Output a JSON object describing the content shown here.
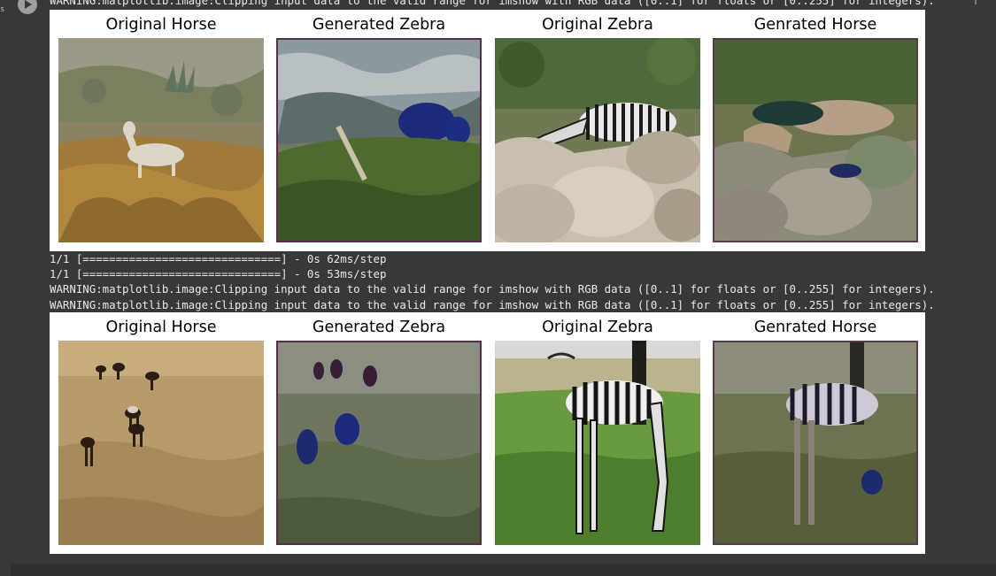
{
  "cell": {
    "exec_count": "s",
    "run_button_label": "Run cell"
  },
  "output": {
    "top_warning": "WARNING:matplotlib.image:Clipping input data to the valid range for imshow with RGB data ([0..1] for floats or [0..255] for integers).",
    "progress_lines": [
      "1/1 [==============================] - 0s 62ms/step",
      "1/1 [==============================] - 0s 53ms/step"
    ],
    "warnings": [
      "WARNING:matplotlib.image:Clipping input data to the valid range for imshow with RGB data ([0..1] for floats or [0..255] for integers).",
      "WARNING:matplotlib.image:Clipping input data to the valid range for imshow with RGB data ([0..1] for floats or [0..255] for integers)."
    ]
  },
  "figures": [
    {
      "titles": [
        "Original Horse",
        "Generated Zebra",
        "Original Zebra",
        "Genrated Horse"
      ]
    },
    {
      "titles": [
        "Original Horse",
        "Generated Zebra",
        "Original Zebra",
        "Genrated Horse"
      ]
    }
  ],
  "icons": {
    "run": "play-icon",
    "scroll": "arrow-up-icon"
  },
  "colors": {
    "background": "#383838",
    "text": "#e8e8e8",
    "figure_bg": "#ffffff"
  }
}
